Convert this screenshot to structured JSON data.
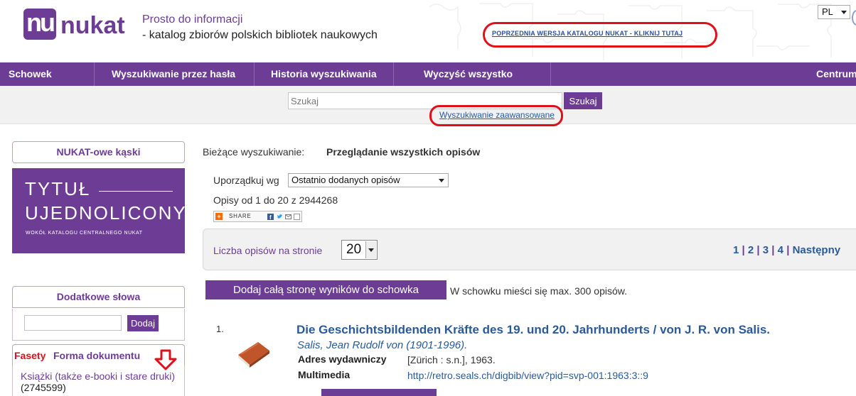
{
  "header": {
    "logo_mark": "nu",
    "logo_text": "nukat",
    "tagline_1": "Prosto do informacji",
    "tagline_2": "- katalog zbiorów polskich bibliotek naukowych",
    "prev_version_link": "POPRZEDNIA WERSJA KATALOGU NUKAT - KLIKNIJ TUTAJ",
    "language": "PL"
  },
  "nav": {
    "items": [
      {
        "label": "Schowek"
      },
      {
        "label": "Wyszukiwanie przez hasła"
      },
      {
        "label": "Historia wyszukiwania"
      },
      {
        "label": "Wyczyść wszystko"
      },
      {
        "label": "Centrum"
      }
    ]
  },
  "search": {
    "placeholder": "Szukaj",
    "button_label": "Szukaj",
    "advanced_link": "Wyszukiwanie zaawansowane"
  },
  "sidebar": {
    "box1_title": "NUKAT-owe kąski",
    "banner": {
      "line1": "TYTUŁ",
      "line2": "UJEDNOLICONY",
      "line3": "WOKÓŁ KATALOGU CENTRALNEGO NUKAT"
    },
    "box2_title": "Dodatkowe słowa",
    "add_button": "Dodaj",
    "facets": {
      "label": "Fasety",
      "name": "Forma dokumentu",
      "items": [
        {
          "label": "Książki (także e-booki i stare druki)",
          "count": "(2745599)"
        }
      ]
    }
  },
  "main": {
    "current_label": "Bieżące wyszukiwanie:",
    "current_value": "Przeglądanie wszystkich opisów",
    "sort_label": "Uporządkuj wg",
    "sort_value": "Ostatnio dodanych opisów",
    "range_text": "Opisy od 1 do 20 z 2944268",
    "share_label": "SHARE",
    "per_page_label": "Liczba opisów na stronie",
    "per_page_value": "20",
    "pager": {
      "pages": [
        "1",
        "2",
        "3",
        "4"
      ],
      "next": "Następny"
    },
    "add_all_button": "Dodaj całą stronę wyników do schowka",
    "note": "W schowku mieści się max. 300 opisów.",
    "results": [
      {
        "number": "1.",
        "title": "Die Geschichtsbildenden Kräfte des 19. und 20. Jahrhunderts / von J. R. von Salis.",
        "author": "Salis, Jean Rudolf von (1901-1996).",
        "field1_label": "Adres wydawniczy",
        "field1_value": "[Zürich : s.n.], 1963.",
        "field2_label": "Multimedia",
        "field2_value": "http://retro.seals.ch/digbib/view?pid=svp-001:1963:3::9"
      }
    ]
  },
  "colors": {
    "brand_purple": "#6d3d95",
    "link_blue": "#2a5a9a",
    "highlight_red": "#e0101a"
  }
}
